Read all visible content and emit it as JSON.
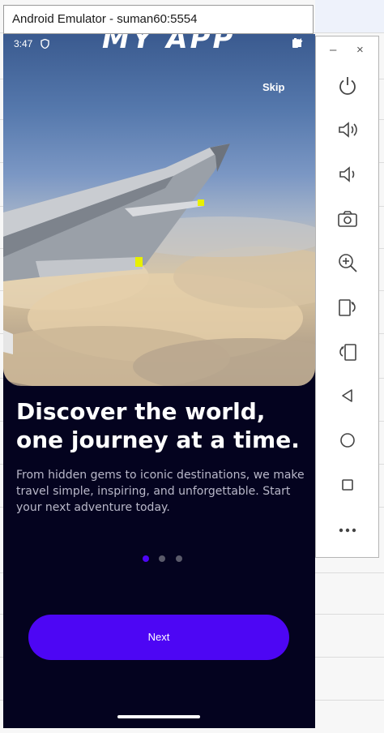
{
  "window": {
    "title": "Android Emulator - suman60:5554"
  },
  "status_bar": {
    "time": "3:47"
  },
  "app": {
    "logo_text": "MY APP",
    "skip_label": "Skip",
    "headline": "Discover the world, one journey at a time.",
    "body": "From hidden gems to iconic destinations, we make travel simple, inspiring, and unforgettable. Start your next adventure today.",
    "next_label": "Next",
    "pagination": {
      "current": 1,
      "total": 3
    }
  },
  "colors": {
    "screen_bg": "#04031f",
    "accent": "#4d06f4",
    "dot_active": "#4d06f4",
    "dot_inactive": "#5a5a6a"
  },
  "toolbar": {
    "minimize_label": "–",
    "close_label": "×",
    "buttons": [
      {
        "name": "power-icon"
      },
      {
        "name": "volume-up-icon"
      },
      {
        "name": "volume-down-icon"
      },
      {
        "name": "camera-icon"
      },
      {
        "name": "zoom-icon"
      },
      {
        "name": "rotate-left-icon"
      },
      {
        "name": "rotate-right-icon"
      },
      {
        "name": "back-icon"
      },
      {
        "name": "home-icon"
      },
      {
        "name": "overview-icon"
      },
      {
        "name": "more-icon"
      }
    ]
  }
}
